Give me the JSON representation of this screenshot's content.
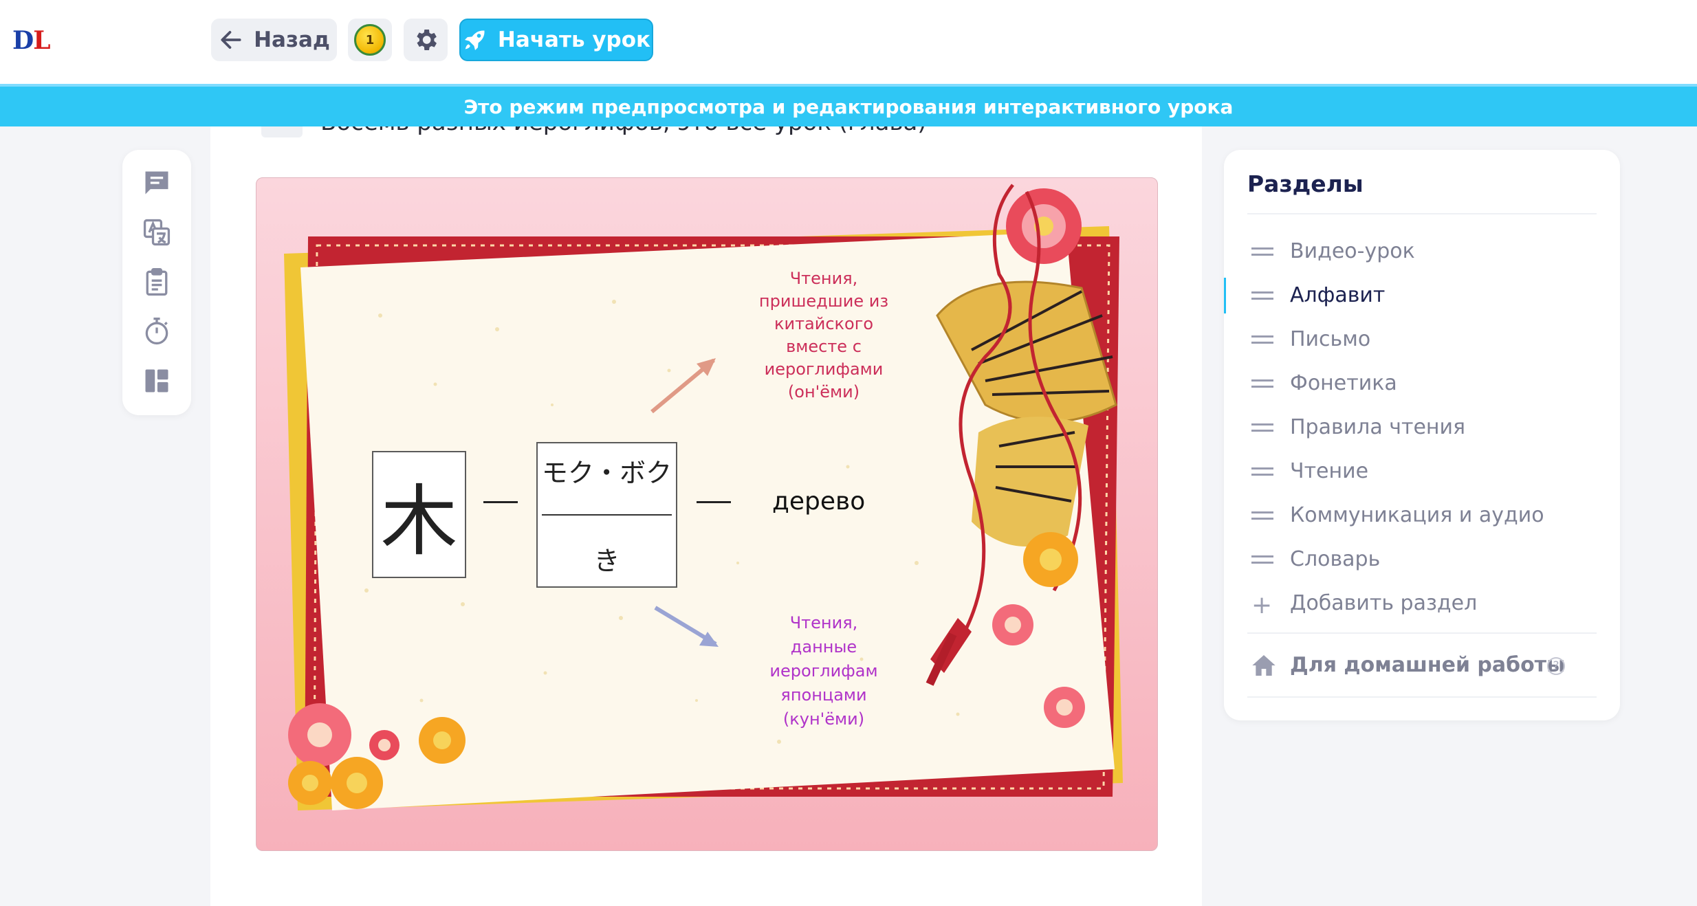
{
  "logo": {
    "d": "D",
    "l": "L"
  },
  "header": {
    "back_label": "Назад",
    "coin_count": "1",
    "start_label": "Начать урок"
  },
  "banner": {
    "text": "Это режим предпросмотра и редактирования интерактивного урока"
  },
  "lesson": {
    "title_fragment": "Восемь разных иероглифов, это все урок (глава)",
    "illustration": {
      "onyomi_note": "Чтения, пришедшие из китайского вместе с иероглифами (он'ёми)",
      "kunyomi_note": "Чтения, данные иероглифам японцами (кун'ёми)",
      "kanji": "木",
      "on_reading": "モク・ボク",
      "kun_reading": "き",
      "meaning": "дерево"
    }
  },
  "sections": {
    "title": "Разделы",
    "items": [
      {
        "label": "Видео-урок"
      },
      {
        "label": "Алфавит"
      },
      {
        "label": "Письмо"
      },
      {
        "label": "Фонетика"
      },
      {
        "label": "Правила чтения"
      },
      {
        "label": "Чтение"
      },
      {
        "label": "Коммуникация и аудио"
      },
      {
        "label": "Словарь"
      }
    ],
    "active": "Алфавит",
    "add_label": "Добавить раздел",
    "homework_label": "Для домашней работы",
    "help_mark": "?"
  },
  "icons": {
    "back": "arrow-left-icon",
    "settings": "gear-icon",
    "start": "rocket-icon",
    "tools": [
      "comment-icon",
      "translate-icon",
      "clipboard-icon",
      "stopwatch-icon",
      "layout-icon"
    ],
    "homework": "home-icon"
  },
  "colors": {
    "accent": "#22bff5",
    "banner": "#2fc7f5",
    "onyomi_text": "#cc2f5a",
    "kunyomi_text": "#b033c9"
  }
}
